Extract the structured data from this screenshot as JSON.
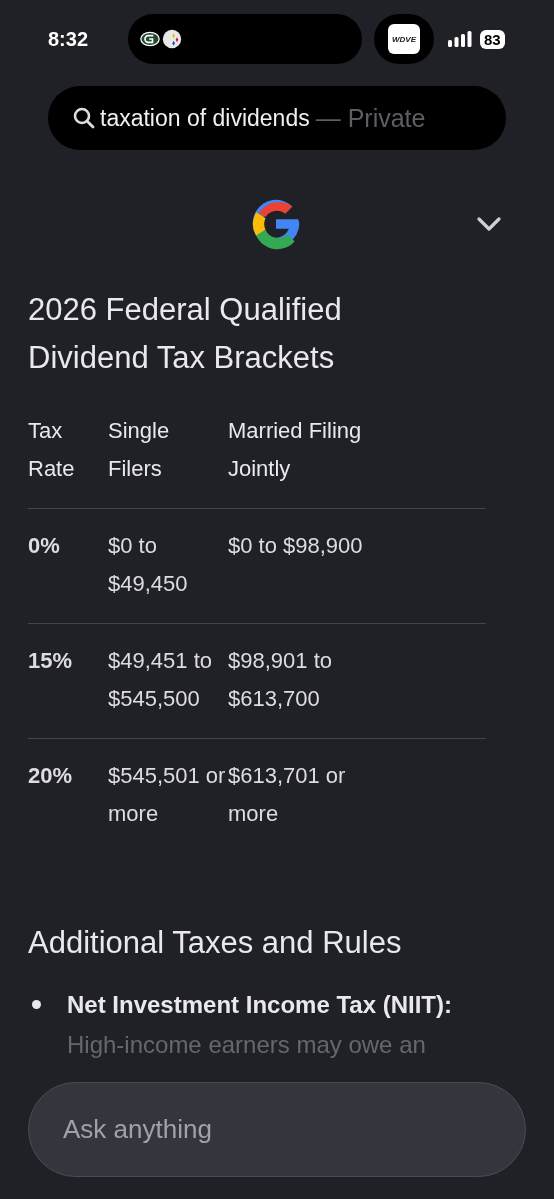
{
  "status_bar": {
    "time": "8:32",
    "live_activity_label": "WDVE",
    "battery": "83"
  },
  "search": {
    "query": "taxation of dividends",
    "mode": "— Private"
  },
  "heading": "2026 Federal Qualified Dividend Tax Brackets",
  "table": {
    "columns": [
      "Tax Rate",
      "Single Filers",
      "Married Filing Jointly"
    ],
    "rows": [
      [
        "0%",
        "$0 to $49,450",
        "$0 to $98,900"
      ],
      [
        "15%",
        "$49,451 to $545,500",
        "$98,901 to $613,700"
      ],
      [
        "20%",
        "$545,501 or more",
        "$613,701 or more"
      ]
    ]
  },
  "section": {
    "title": "Additional Taxes and Rules",
    "bullets": [
      {
        "term": "Net Investment Income Tax (NIIT):",
        "text": "High-income earners may owe an"
      }
    ]
  },
  "ask": {
    "placeholder": "Ask anything"
  }
}
